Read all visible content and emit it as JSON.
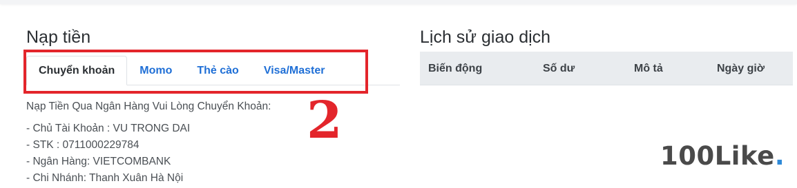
{
  "deposit": {
    "title": "Nạp tiền",
    "tabs": [
      {
        "label": "Chuyển khoản",
        "active": true
      },
      {
        "label": "Momo",
        "active": false
      },
      {
        "label": "Thẻ cào",
        "active": false
      },
      {
        "label": "Visa/Master",
        "active": false
      }
    ],
    "intro": "Nạp Tiền Qua Ngân Hàng Vui Lòng Chuyển Khoản:",
    "details": [
      "- Chủ Tài Khoản : VU TRONG DAI",
      "- STK : 0711000229784",
      "- Ngân Hàng: VIETCOMBANK",
      "- Chi Nhánh: Thanh Xuân Hà Nội"
    ]
  },
  "annotation": {
    "step_number": "2",
    "color": "#e3252b"
  },
  "history": {
    "title": "Lịch sử giao dịch",
    "columns": [
      "Biến động",
      "Số dư",
      "Mô tả",
      "Ngày giờ"
    ]
  },
  "watermark": {
    "text": "100Like",
    "dot": ".",
    "dot_color": "#2f8ad8"
  },
  "colors": {
    "link": "#1f6fd6",
    "table_header_bg": "#e9ecef"
  }
}
